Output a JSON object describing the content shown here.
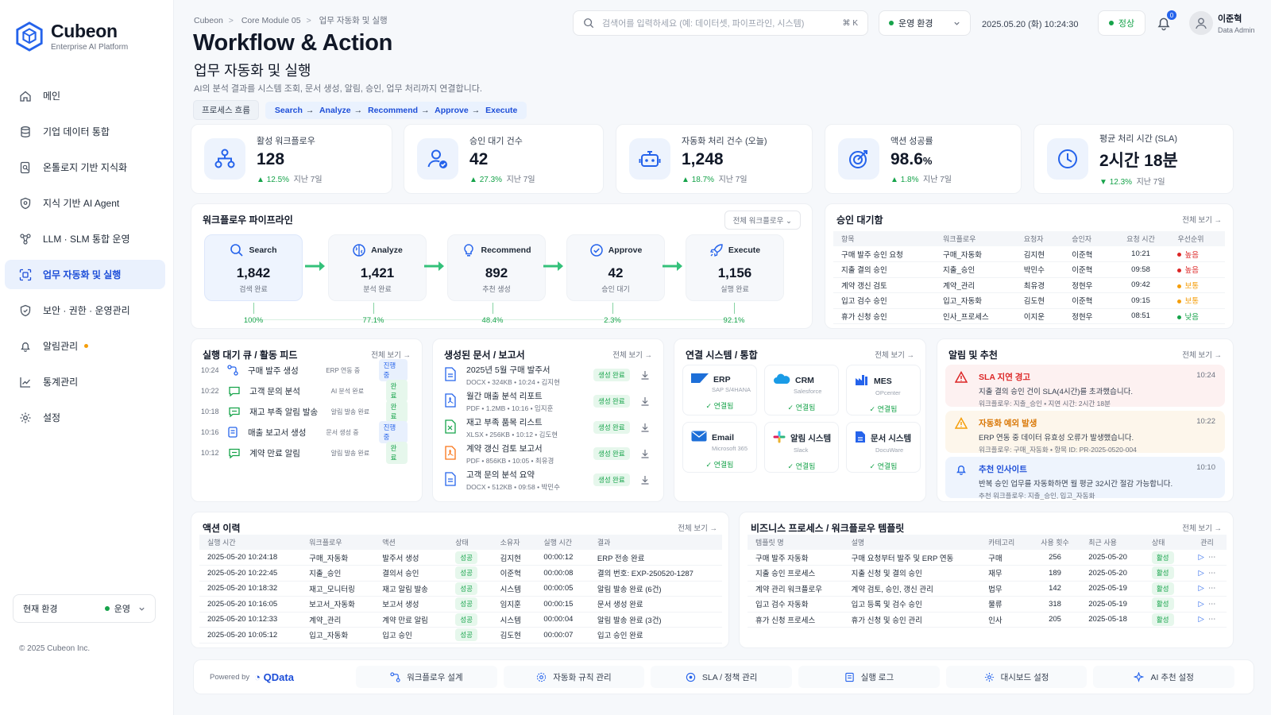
{
  "app": {
    "name": "Cubeon",
    "subtitle": "Enterprise AI Platform"
  },
  "nav": [
    {
      "label": "메인",
      "icon": "home-icon"
    },
    {
      "label": "기업 데이터 통합",
      "icon": "database-icon"
    },
    {
      "label": "온톨로지 기반 지식화",
      "icon": "knowledge-icon"
    },
    {
      "label": "지식 기반 AI Agent",
      "icon": "shield-icon"
    },
    {
      "label": "LLM · SLM 통합 운영",
      "icon": "model-icon"
    },
    {
      "label": "업무 자동화 및 실행",
      "icon": "automation-icon",
      "active": true
    },
    {
      "label": "보안 · 권한 · 운영관리",
      "icon": "security-icon"
    },
    {
      "label": "알림관리",
      "icon": "bell-icon",
      "dot": true
    },
    {
      "label": "통계관리",
      "icon": "chart-icon"
    },
    {
      "label": "설정",
      "icon": "gear-icon"
    }
  ],
  "env": {
    "label": "현재 환경",
    "value": "운영"
  },
  "copyright": "© 2025 Cubeon Inc.",
  "breadcrumb": [
    "Cubeon",
    "Core Module 05",
    "업무 자동화 및 실행"
  ],
  "page": {
    "title": "Workflow & Action",
    "subtitle": "업무 자동화 및 실행",
    "description": "AI의 분석 결과를 시스템 조회, 문서 생성, 알림, 승인, 업무 처리까지 연결합니다.",
    "flow_label": "프로세스 흐름",
    "flow_steps": [
      "Search",
      "Analyze",
      "Recommend",
      "Approve",
      "Execute"
    ]
  },
  "header": {
    "search_placeholder": "검색어를 입력하세요 (예: 데이터셋, 파이프라인, 시스템)",
    "search_shortcut": "⌘ K",
    "run_env": "운영 환경",
    "datetime": "2025.05.20 (화) 10:24:30",
    "status": "정상",
    "notif_count": "0",
    "user_name": "이준혁",
    "user_role": "Data Admin"
  },
  "kpis": [
    {
      "title": "활성 워크플로우",
      "value": "128",
      "unit": "",
      "delta": "12.5%",
      "period": "지난 7일",
      "icon": "workflow-icon"
    },
    {
      "title": "승인 대기 건수",
      "value": "42",
      "unit": "",
      "delta": "27.3%",
      "period": "지난 7일",
      "icon": "user-check-icon"
    },
    {
      "title": "자동화 처리 건수 (오늘)",
      "value": "1,248",
      "unit": "",
      "delta": "18.7%",
      "period": "지난 7일",
      "icon": "robot-icon"
    },
    {
      "title": "액션 성공률",
      "value": "98.6",
      "unit": "%",
      "delta": "1.8%",
      "period": "지난 7일",
      "icon": "target-icon"
    },
    {
      "title": "평균 처리 시간 (SLA)",
      "value": "2시간 18분",
      "unit": "",
      "delta": "12.3%",
      "period": "지난 7일",
      "icon": "clock-icon"
    }
  ],
  "pipeline": {
    "title": "워크플로우 파이프라인",
    "filter": "전체 워크플로우",
    "stages": [
      {
        "name": "Search",
        "value": "1,842",
        "sub": "검색 완료",
        "pct": "100%",
        "icon": "search-icon"
      },
      {
        "name": "Analyze",
        "value": "1,421",
        "sub": "분석 완료",
        "pct": "77.1%",
        "icon": "brain-icon"
      },
      {
        "name": "Recommend",
        "value": "892",
        "sub": "추천 생성",
        "pct": "48.4%",
        "icon": "bulb-icon"
      },
      {
        "name": "Approve",
        "value": "42",
        "sub": "승인 대기",
        "pct": "2.3%",
        "icon": "check-circle-icon"
      },
      {
        "name": "Execute",
        "value": "1,156",
        "sub": "실행 완료",
        "pct": "92.1%",
        "icon": "rocket-icon"
      }
    ]
  },
  "approvals": {
    "title": "승인 대기함",
    "view_all": "전체 보기 →",
    "columns": [
      "항목",
      "워크플로우",
      "요청자",
      "승인자",
      "요청 시간",
      "우선순위"
    ],
    "rows": [
      [
        "구매 발주 승인 요청",
        "구매_자동화",
        "김지현",
        "이준혁",
        "10:21",
        "높음"
      ],
      [
        "지출 결의 승인",
        "지출_승인",
        "박민수",
        "이준혁",
        "09:58",
        "높음"
      ],
      [
        "계약 갱신 검토",
        "계약_관리",
        "최유경",
        "정현우",
        "09:42",
        "보통"
      ],
      [
        "입고 검수 승인",
        "입고_자동화",
        "김도현",
        "이준혁",
        "09:15",
        "보통"
      ],
      [
        "휴가 신청 승인",
        "인사_프로세스",
        "이지운",
        "정현우",
        "08:51",
        "낮음"
      ]
    ]
  },
  "queue": {
    "title": "실행 대기 큐 / 활동 피드",
    "view_all": "전체 보기 →",
    "items": [
      {
        "time": "10:24",
        "name": "구매 발주 생성",
        "system": "ERP 연동 중",
        "status": "진행 중"
      },
      {
        "time": "10:22",
        "name": "고객 문의 분석",
        "system": "AI 분석 완료",
        "status": "완료"
      },
      {
        "time": "10:18",
        "name": "재고 부족 알림 발송",
        "system": "알림 발송 완료",
        "status": "완료"
      },
      {
        "time": "10:16",
        "name": "매출 보고서 생성",
        "system": "문서 생성 중",
        "status": "진행 중"
      },
      {
        "time": "10:12",
        "name": "계약 만료 알림",
        "system": "알림 발송 완료",
        "status": "완료"
      }
    ]
  },
  "documents": {
    "title": "생성된 문서 / 보고서",
    "view_all": "전체 보기 →",
    "items": [
      {
        "title": "2025년 5월 구매 발주서",
        "meta": "DOCX  •  324KB  •  10:24  •  김지현",
        "status": "생성 완료"
      },
      {
        "title": "월간 매출 분석 리포트",
        "meta": "PDF  •  1.2MB  •  10:16  •  임지훈",
        "status": "생성 완료"
      },
      {
        "title": "재고 부족 품목 리스트",
        "meta": "XLSX  •  256KB  •  10:12  •  김도현",
        "status": "생성 완료"
      },
      {
        "title": "계약 갱신 검토 보고서",
        "meta": "PDF  •  856KB  •  10:05  •  최유경",
        "status": "생성 완료"
      },
      {
        "title": "고객 문의 분석 요약",
        "meta": "DOCX  •  512KB  •  09:58  •  박민수",
        "status": "생성 완료"
      }
    ]
  },
  "systems": {
    "title": "연결 시스템 / 통합",
    "view_all": "전체 보기 →",
    "items": [
      {
        "name": "ERP",
        "sub": "SAP S/4HANA",
        "status": "연결됨"
      },
      {
        "name": "CRM",
        "sub": "Salesforce",
        "status": "연결됨"
      },
      {
        "name": "MES",
        "sub": "OPcenter",
        "status": "연결됨"
      },
      {
        "name": "Email",
        "sub": "Microsoft 365",
        "status": "연결됨"
      },
      {
        "name": "알림 시스템",
        "sub": "Slack",
        "status": "연결됨"
      },
      {
        "name": "문서 시스템",
        "sub": "DocuWare",
        "status": "연결됨"
      }
    ]
  },
  "alerts": {
    "title": "알림 및 추천",
    "view_all": "전체 보기 →",
    "items": [
      {
        "title": "SLA 지연 경고",
        "time": "10:24",
        "message": "지출 결의 승인 건이 SLA(4시간)를 초과했습니다.",
        "sub": "워크플로우: 지출_승인   •   지연 시간: 2시간 18분",
        "tone": "red"
      },
      {
        "title": "자동화 예외 발생",
        "time": "10:22",
        "message": "ERP 연동 중 데이터 유효성 오류가 발생했습니다.",
        "sub": "워크플로우: 구매_자동화   •   항목 ID: PR-2025-0520-004",
        "tone": "amber"
      },
      {
        "title": "추천 인사이트",
        "time": "10:10",
        "message": "반복 승인 업무를 자동화하면 월 평균 32시간 절감 가능합니다.",
        "sub": "추천 워크플로우: 지출_승인, 입고_자동화",
        "tone": "blue"
      }
    ]
  },
  "history": {
    "title": "액션 이력",
    "view_all": "전체 보기 →",
    "columns": [
      "실행 시간",
      "워크플로우",
      "액션",
      "상태",
      "소유자",
      "실행 시간",
      "결과"
    ],
    "rows": [
      [
        "2025-05-20 10:24:18",
        "구매_자동화",
        "발주서 생성",
        "성공",
        "김지현",
        "00:00:12",
        "ERP 전송 완료"
      ],
      [
        "2025-05-20 10:22:45",
        "지출_승인",
        "결의서 승인",
        "성공",
        "이준혁",
        "00:00:08",
        "결의 번호: EXP-250520-1287"
      ],
      [
        "2025-05-20 10:18:32",
        "재고_모니터링",
        "재고 알림 발송",
        "성공",
        "시스템",
        "00:00:05",
        "알림 발송 완료 (6건)"
      ],
      [
        "2025-05-20 10:16:05",
        "보고서_자동화",
        "보고서 생성",
        "성공",
        "임지훈",
        "00:00:15",
        "문서 생성 완료"
      ],
      [
        "2025-05-20 10:12:33",
        "계약_관리",
        "계약 만료 알림",
        "성공",
        "시스템",
        "00:00:04",
        "알림 발송 완료 (3건)"
      ],
      [
        "2025-05-20 10:05:12",
        "입고_자동화",
        "입고 승인",
        "성공",
        "김도현",
        "00:00:07",
        "입고 승인 완료"
      ]
    ]
  },
  "templates": {
    "title": "비즈니스 프로세스 / 워크플로우 템플릿",
    "view_all": "전체 보기 →",
    "columns": [
      "템플릿 명",
      "설명",
      "카테고리",
      "사용 횟수",
      "최근 사용",
      "상태",
      "관리"
    ],
    "rows": [
      [
        "구매 발주 자동화",
        "구매 요청부터 발주 및 ERP 연동",
        "구매",
        "256",
        "2025-05-20",
        "활성"
      ],
      [
        "지출 승인 프로세스",
        "지출 신청 및 결의 승인",
        "재무",
        "189",
        "2025-05-20",
        "활성"
      ],
      [
        "계약 관리 워크플로우",
        "계약 검토, 승인, 갱신 관리",
        "법무",
        "142",
        "2025-05-19",
        "활성"
      ],
      [
        "입고 검수 자동화",
        "입고 등록 및 검수 승인",
        "물류",
        "318",
        "2025-05-19",
        "활성"
      ],
      [
        "휴가 신청 프로세스",
        "휴가 신청 및 승인 관리",
        "인사",
        "205",
        "2025-05-18",
        "활성"
      ]
    ]
  },
  "footer": {
    "powered_by": "Powered by",
    "brand": "QData",
    "links": [
      "워크플로우 설계",
      "자동화 규칙 관리",
      "SLA / 정책 관리",
      "실행 로그",
      "대시보드 설정",
      "AI 추천 설정"
    ]
  },
  "colors": {
    "accent": "#2563eb",
    "success": "#16a34a",
    "danger": "#dc2626",
    "warning": "#f59e0b",
    "pipeline_arrow": "#34c17a"
  }
}
